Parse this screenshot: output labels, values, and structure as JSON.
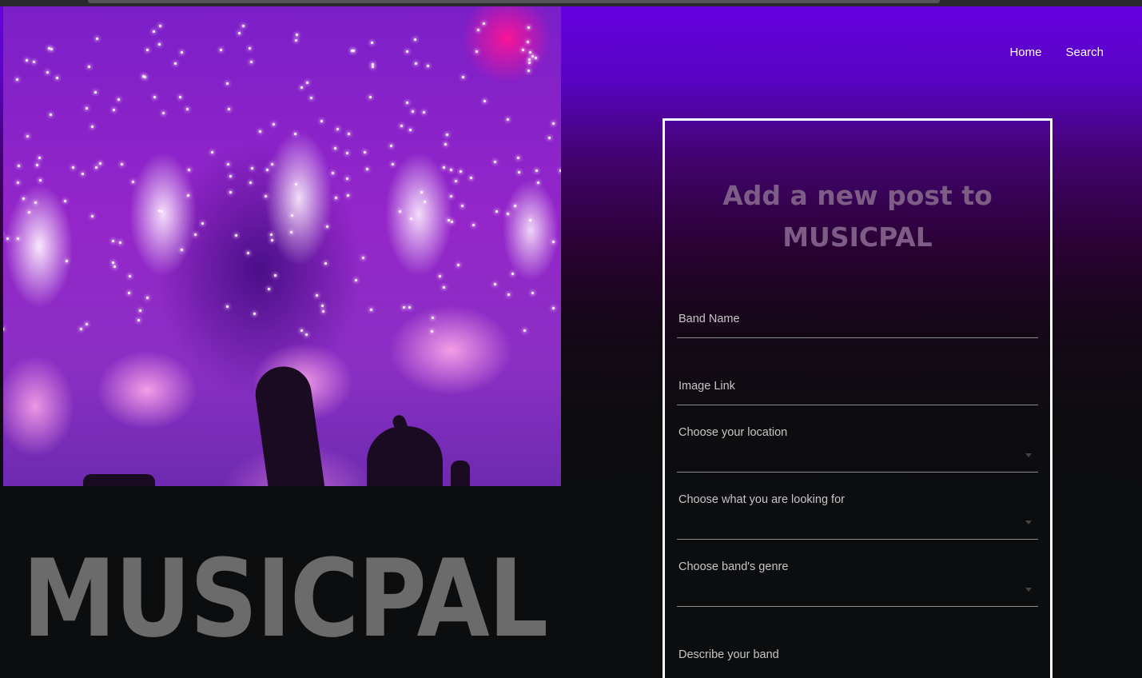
{
  "nav": {
    "home": "Home",
    "search": "Search"
  },
  "brand": {
    "logo_text": "MUSICPAL"
  },
  "form": {
    "title_line1": "Add a new post to",
    "title_line2": "MUSICPAL",
    "band_name_label": "Band Name",
    "band_name_value": "",
    "image_link_label": "Image Link",
    "image_link_value": "",
    "location_label": "Choose your location",
    "location_value": "",
    "looking_for_label": "Choose what you are looking for",
    "looking_for_value": "",
    "genre_label": "Choose band's genre",
    "genre_value": "",
    "describe_label": "Describe your band"
  },
  "hero_image": {
    "icon": "concert-fireworks-photo"
  },
  "colors": {
    "gradient_top": "#6400e0",
    "background": "#0b0d0e",
    "logo": "#6b6b6b",
    "form_title": "#7d5c86"
  }
}
